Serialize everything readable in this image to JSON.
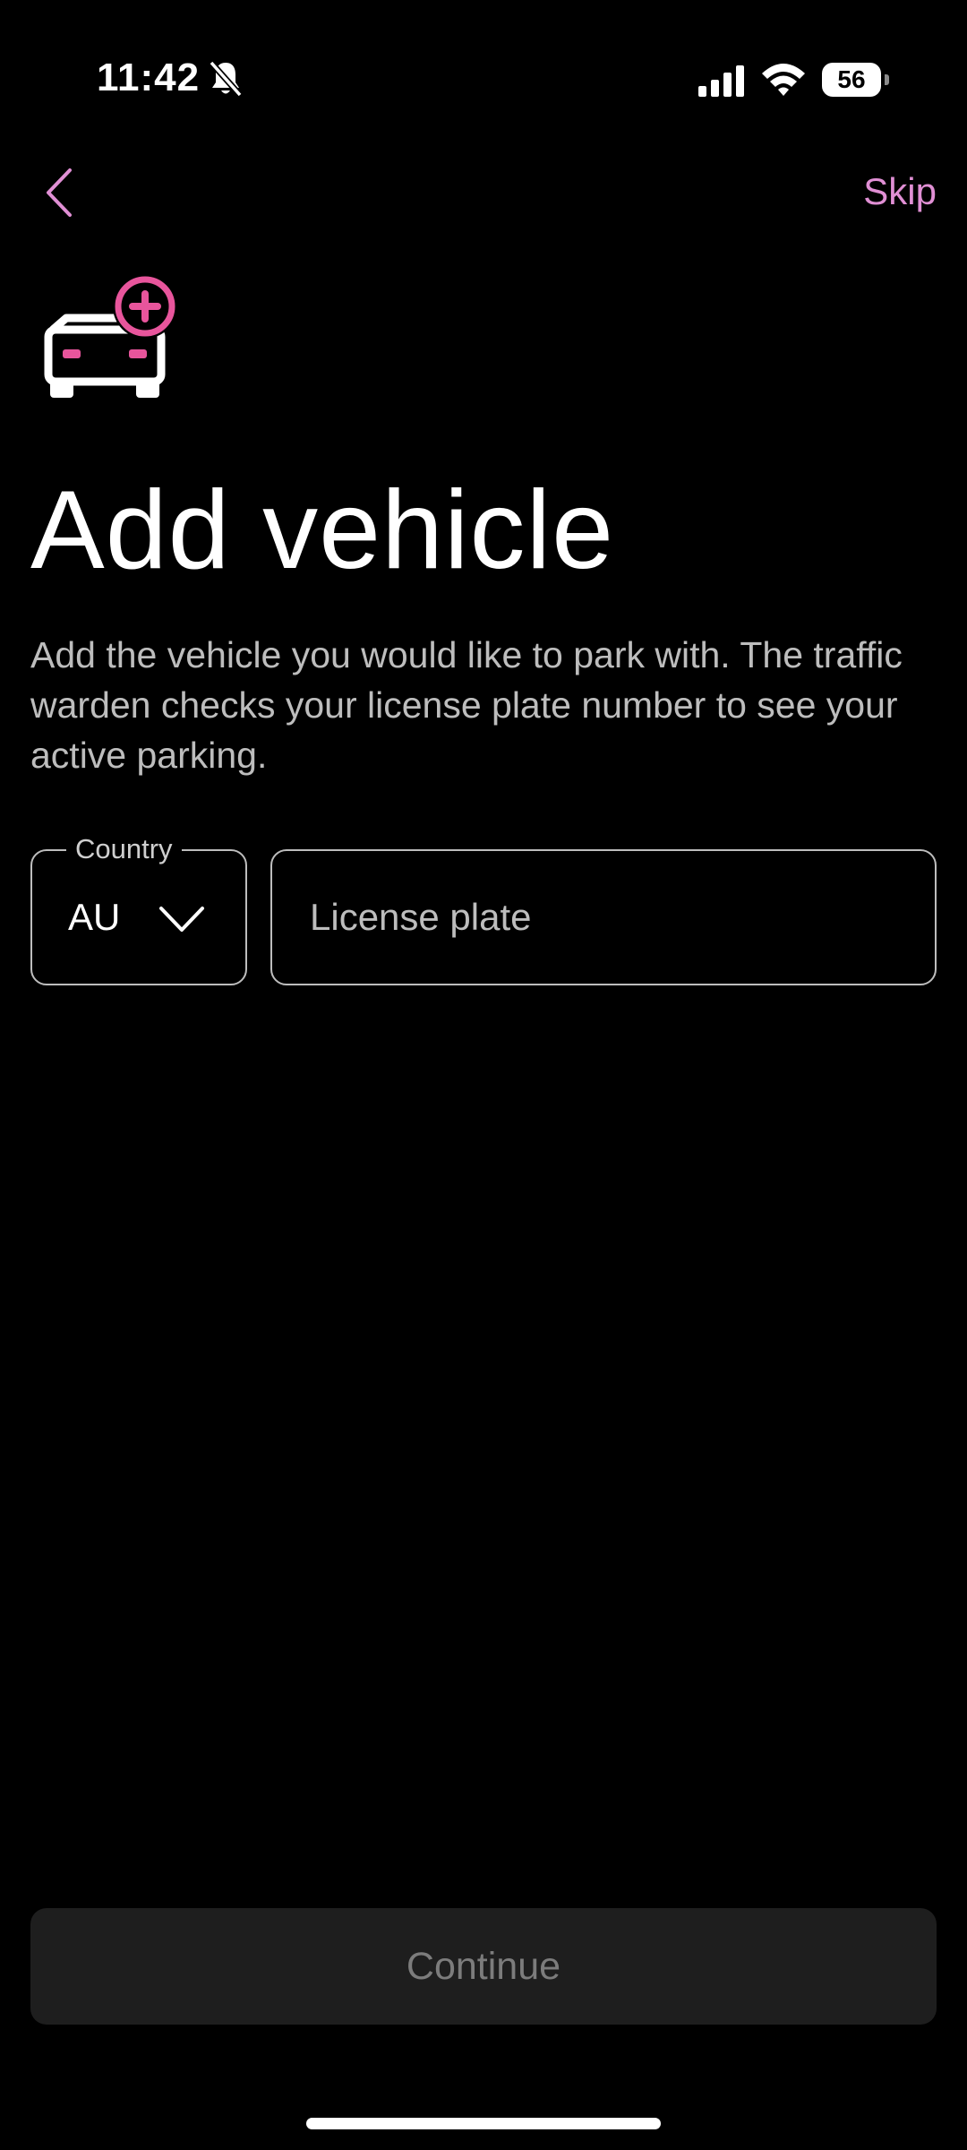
{
  "status_bar": {
    "time": "11:42",
    "battery": "56"
  },
  "nav": {
    "skip_label": "Skip"
  },
  "page": {
    "title": "Add vehicle",
    "description": "Add the vehicle you would like to park with. The traffic warden checks your license plate number to see your active parking."
  },
  "form": {
    "country_label": "Country",
    "country_value": "AU",
    "plate_placeholder": "License plate",
    "plate_value": ""
  },
  "actions": {
    "continue_label": "Continue"
  },
  "colors": {
    "accent_pink": "#e8559c",
    "link_pink": "#e08fd4",
    "background": "#000000"
  }
}
